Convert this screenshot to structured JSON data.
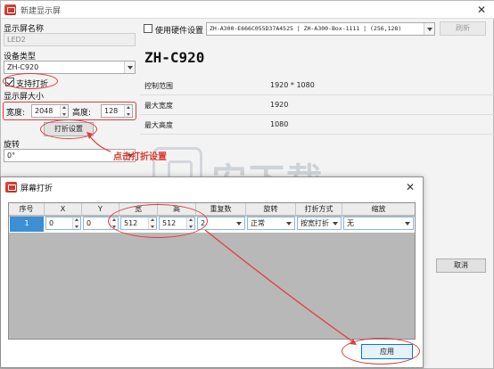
{
  "main_window": {
    "title": "新建显示屏",
    "close_glyph": "✕"
  },
  "left_panel": {
    "display_name_label": "显示屏名称",
    "display_name_value": "LED2",
    "device_type_label": "设备类型",
    "device_type_value": "ZH-C920",
    "fold_checkbox_label": "支持打折",
    "fold_checked": true,
    "size_label": "显示屏大小",
    "width_label": "宽度:",
    "width_value": "2048",
    "height_label": "高度:",
    "height_value": "128",
    "fold_settings_button": "打折设置",
    "rotate_label": "旋转",
    "rotate_value": "0°"
  },
  "top_bar": {
    "hardware_checkbox_label": "使用硬件设置",
    "hardware_checked": false,
    "hardware_combo_value": "ZH-A300-E666C055D37A4525 | ZH-A300-Box-1111 | (256,128)",
    "refresh_button": "刷新"
  },
  "device_info": {
    "model_title": "ZH-C920",
    "rows": [
      {
        "key": "控制范围",
        "value": "1920 * 1080"
      },
      {
        "key": "最大宽度",
        "value": "1920"
      },
      {
        "key": "最大高度",
        "value": "1080"
      }
    ]
  },
  "cancel_button": "取消",
  "annotation": "点击打折设置",
  "watermark": "安下载",
  "dialog": {
    "title": "屏幕打折",
    "close_glyph": "✕",
    "headers": [
      "序号",
      "X",
      "Y",
      "宽",
      "高",
      "重复数",
      "旋转",
      "打折方式",
      "缩放"
    ],
    "row": {
      "index": "1",
      "x": "0",
      "y": "0",
      "width": "512",
      "height": "512",
      "repeat": "2",
      "rotate": "正常",
      "fold_mode": "按宽打折",
      "scale": "无"
    },
    "apply_button": "应用"
  },
  "colors": {
    "annotation_red": "#e23b3b",
    "selection_blue": "#3c8fd5",
    "app_icon_red": "#e84b3c"
  },
  "icons": [
    "app-icon",
    "close-icon",
    "checkbox-icon",
    "dropdown-arrow-icon",
    "spinner-icon",
    "watermark-shield-icon"
  ]
}
